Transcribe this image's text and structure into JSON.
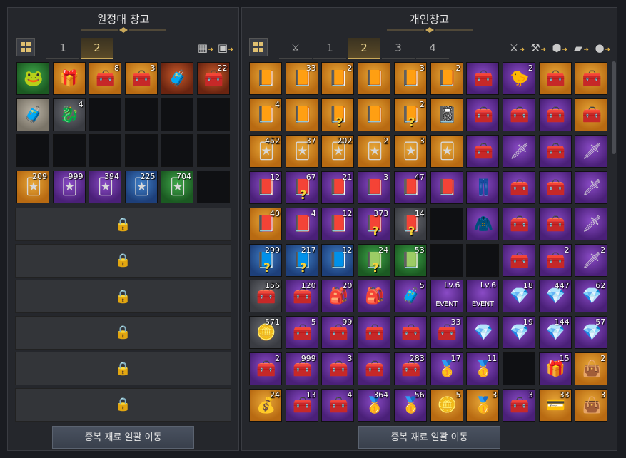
{
  "left_panel": {
    "title": "원정대 창고",
    "tabs": [
      "1",
      "2"
    ],
    "active_tab": 1,
    "button": "중복 재료 일괄 이동",
    "icons": [
      "vault-sort-icon",
      "chest-stack-icon"
    ],
    "slots": [
      {
        "icon": "frog-orb",
        "glyph": "🐸",
        "rarity": "green",
        "count": ""
      },
      {
        "icon": "gift-box",
        "glyph": "🎁",
        "rarity": "orange",
        "count": ""
      },
      {
        "icon": "silver-chest",
        "glyph": "🧰",
        "rarity": "orange",
        "count": "8"
      },
      {
        "icon": "silver-chest",
        "glyph": "🧰",
        "rarity": "orange",
        "count": "3"
      },
      {
        "icon": "ornate-chest",
        "glyph": "🧳",
        "rarity": "relic",
        "count": ""
      },
      {
        "icon": "silver-chest",
        "glyph": "🧰",
        "rarity": "relic",
        "count": "22"
      },
      {
        "icon": "pink-chest",
        "glyph": "🧳",
        "rarity": "white",
        "count": ""
      },
      {
        "icon": "golden-mount",
        "glyph": "🐉",
        "rarity": "gray",
        "count": "4"
      },
      {
        "icon": "empty",
        "glyph": "",
        "rarity": "empty",
        "count": ""
      },
      {
        "icon": "empty",
        "glyph": "",
        "rarity": "empty",
        "count": ""
      },
      {
        "icon": "empty",
        "glyph": "",
        "rarity": "empty",
        "count": ""
      },
      {
        "icon": "empty",
        "glyph": "",
        "rarity": "empty",
        "count": ""
      },
      {
        "icon": "empty",
        "glyph": "",
        "rarity": "empty",
        "count": ""
      },
      {
        "icon": "empty",
        "glyph": "",
        "rarity": "empty",
        "count": ""
      },
      {
        "icon": "empty",
        "glyph": "",
        "rarity": "empty",
        "count": ""
      },
      {
        "icon": "empty",
        "glyph": "",
        "rarity": "empty",
        "count": ""
      },
      {
        "icon": "empty",
        "glyph": "",
        "rarity": "empty",
        "count": ""
      },
      {
        "icon": "empty",
        "glyph": "",
        "rarity": "empty",
        "count": ""
      },
      {
        "icon": "card-pack",
        "glyph": "🃏",
        "rarity": "orange",
        "count": "209"
      },
      {
        "icon": "card-pack",
        "glyph": "🃏",
        "rarity": "purple",
        "count": "999"
      },
      {
        "icon": "card-pack",
        "glyph": "🃏",
        "rarity": "purple",
        "count": "394"
      },
      {
        "icon": "card-pack",
        "glyph": "🃏",
        "rarity": "blue",
        "count": "225"
      },
      {
        "icon": "card-pack",
        "glyph": "🃏",
        "rarity": "green",
        "count": "704"
      },
      {
        "icon": "empty",
        "glyph": "",
        "rarity": "empty",
        "count": ""
      }
    ],
    "locked_rows": 6
  },
  "right_panel": {
    "title": "개인창고",
    "tabs": [
      "1",
      "2",
      "3",
      "4"
    ],
    "active_tab": 1,
    "button": "중복 재료 일괄 이동",
    "icons": [
      "crossed-swords-icon",
      "tool-icon",
      "gem-icon",
      "cards-icon",
      "chat-icon"
    ],
    "rows": [
      [
        {
          "g": "📙",
          "r": "orange",
          "c": ""
        },
        {
          "g": "📙",
          "r": "orange",
          "c": "33"
        },
        {
          "g": "📙",
          "r": "orange",
          "c": "2"
        },
        {
          "g": "📙",
          "r": "orange",
          "c": ""
        },
        {
          "g": "📙",
          "r": "orange",
          "c": "3"
        },
        {
          "g": "📙",
          "r": "orange",
          "c": "2"
        },
        {
          "g": "🧰",
          "r": "purple",
          "c": ""
        },
        {
          "g": "🐤",
          "r": "purple",
          "c": "2"
        },
        {
          "g": "🧰",
          "r": "orange",
          "c": ""
        },
        {
          "g": "🧰",
          "r": "orange",
          "c": ""
        }
      ],
      [
        {
          "g": "📙",
          "r": "orange",
          "c": "4"
        },
        {
          "g": "📙",
          "r": "orange",
          "c": ""
        },
        {
          "g": "📙",
          "r": "orange",
          "c": "",
          "q": true
        },
        {
          "g": "📙",
          "r": "orange",
          "c": ""
        },
        {
          "g": "📙",
          "r": "orange",
          "c": "2",
          "q": true
        },
        {
          "g": "📓",
          "r": "orange",
          "c": ""
        },
        {
          "g": "🧰",
          "r": "purple",
          "c": ""
        },
        {
          "g": "🧰",
          "r": "purple",
          "c": ""
        },
        {
          "g": "🧰",
          "r": "purple",
          "c": ""
        },
        {
          "g": "🧰",
          "r": "orange",
          "c": ""
        }
      ],
      [
        {
          "g": "🃏",
          "r": "orange",
          "c": "452"
        },
        {
          "g": "🃏",
          "r": "orange",
          "c": "37"
        },
        {
          "g": "🃏",
          "r": "orange",
          "c": "202"
        },
        {
          "g": "🃏",
          "r": "orange",
          "c": "2"
        },
        {
          "g": "🃏",
          "r": "orange",
          "c": "3"
        },
        {
          "g": "🃏",
          "r": "orange",
          "c": ""
        },
        {
          "g": "🧰",
          "r": "purple",
          "c": ""
        },
        {
          "g": "🗡",
          "r": "purple",
          "c": ""
        },
        {
          "g": "🧰",
          "r": "purple",
          "c": ""
        },
        {
          "g": "🗡",
          "r": "purple",
          "c": ""
        }
      ],
      [
        {
          "g": "📕",
          "r": "purple",
          "c": "12"
        },
        {
          "g": "📕",
          "r": "purple",
          "c": "67",
          "q": true
        },
        {
          "g": "📕",
          "r": "purple",
          "c": "21"
        },
        {
          "g": "📕",
          "r": "purple",
          "c": "3"
        },
        {
          "g": "📕",
          "r": "purple",
          "c": "47"
        },
        {
          "g": "📕",
          "r": "purple",
          "c": ""
        },
        {
          "g": "👖",
          "r": "purple",
          "c": ""
        },
        {
          "g": "🧰",
          "r": "purple",
          "c": ""
        },
        {
          "g": "🧰",
          "r": "purple",
          "c": ""
        },
        {
          "g": "🗡",
          "r": "purple",
          "c": ""
        }
      ],
      [
        {
          "g": "📕",
          "r": "orange",
          "c": "40"
        },
        {
          "g": "📕",
          "r": "purple",
          "c": "4"
        },
        {
          "g": "📕",
          "r": "purple",
          "c": "12"
        },
        {
          "g": "📕",
          "r": "purple",
          "c": "373",
          "q": true
        },
        {
          "g": "📕",
          "r": "gray",
          "c": "14",
          "q": true
        },
        {
          "g": "",
          "r": "empty",
          "c": ""
        },
        {
          "g": "🧥",
          "r": "purple",
          "c": ""
        },
        {
          "g": "🧰",
          "r": "purple",
          "c": ""
        },
        {
          "g": "🧰",
          "r": "purple",
          "c": ""
        },
        {
          "g": "🗡",
          "r": "purple",
          "c": ""
        }
      ],
      [
        {
          "g": "📘",
          "r": "blue",
          "c": "299",
          "q": true
        },
        {
          "g": "📘",
          "r": "blue",
          "c": "217",
          "q": true
        },
        {
          "g": "📘",
          "r": "blue",
          "c": "12"
        },
        {
          "g": "📗",
          "r": "green",
          "c": "24",
          "q": true
        },
        {
          "g": "📗",
          "r": "green",
          "c": "53"
        },
        {
          "g": "",
          "r": "empty",
          "c": ""
        },
        {
          "g": "",
          "r": "empty",
          "c": ""
        },
        {
          "g": "🧰",
          "r": "purple",
          "c": ""
        },
        {
          "g": "🧰",
          "r": "purple",
          "c": "2"
        },
        {
          "g": "🗡",
          "r": "purple",
          "c": "2"
        }
      ],
      [
        {
          "g": "🧰",
          "r": "gray",
          "c": "156"
        },
        {
          "g": "🧰",
          "r": "purple",
          "c": "120"
        },
        {
          "g": "🎒",
          "r": "purple",
          "c": "20"
        },
        {
          "g": "🎒",
          "r": "purple",
          "c": ""
        },
        {
          "g": "🧳",
          "r": "purple",
          "c": "5"
        },
        {
          "g": "",
          "r": "purple",
          "c": "",
          "lv": "Lv.6",
          "ev": "EVENT"
        },
        {
          "g": "",
          "r": "purple",
          "c": "",
          "lv": "Lv.6",
          "ev": "EVENT"
        },
        {
          "g": "💎",
          "r": "purple",
          "c": "18"
        },
        {
          "g": "💎",
          "r": "purple",
          "c": "447"
        },
        {
          "g": "💎",
          "r": "purple",
          "c": "62"
        }
      ],
      [
        {
          "g": "🪙",
          "r": "gray",
          "c": "571"
        },
        {
          "g": "🧰",
          "r": "purple",
          "c": "5"
        },
        {
          "g": "🧰",
          "r": "purple",
          "c": "99"
        },
        {
          "g": "🧰",
          "r": "purple",
          "c": ""
        },
        {
          "g": "🧰",
          "r": "purple",
          "c": ""
        },
        {
          "g": "🧰",
          "r": "purple",
          "c": "33"
        },
        {
          "g": "💎",
          "r": "purple",
          "c": ""
        },
        {
          "g": "💎",
          "r": "purple",
          "c": "19"
        },
        {
          "g": "💎",
          "r": "purple",
          "c": "144"
        },
        {
          "g": "💎",
          "r": "purple",
          "c": "57"
        }
      ],
      [
        {
          "g": "🧰",
          "r": "purple",
          "c": "2"
        },
        {
          "g": "🧰",
          "r": "purple",
          "c": "999"
        },
        {
          "g": "🧰",
          "r": "purple",
          "c": "3"
        },
        {
          "g": "🧰",
          "r": "purple",
          "c": ""
        },
        {
          "g": "🧰",
          "r": "purple",
          "c": "283"
        },
        {
          "g": "🥇",
          "r": "purple",
          "c": "17"
        },
        {
          "g": "🥇",
          "r": "purple",
          "c": "11"
        },
        {
          "g": "",
          "r": "empty",
          "c": ""
        },
        {
          "g": "🎁",
          "r": "purple",
          "c": "15"
        },
        {
          "g": "👜",
          "r": "orange",
          "c": "2"
        }
      ],
      [
        {
          "g": "💰",
          "r": "orange",
          "c": "24"
        },
        {
          "g": "🧰",
          "r": "purple",
          "c": "13"
        },
        {
          "g": "🧰",
          "r": "purple",
          "c": "4"
        },
        {
          "g": "🥇",
          "r": "purple",
          "c": "364"
        },
        {
          "g": "🥇",
          "r": "purple",
          "c": "56"
        },
        {
          "g": "🪙",
          "r": "orange",
          "c": "5"
        },
        {
          "g": "🥇",
          "r": "orange",
          "c": "3"
        },
        {
          "g": "🧰",
          "r": "purple",
          "c": "3"
        },
        {
          "g": "💳",
          "r": "orange",
          "c": "33"
        },
        {
          "g": "👜",
          "r": "orange",
          "c": "3"
        }
      ]
    ]
  }
}
